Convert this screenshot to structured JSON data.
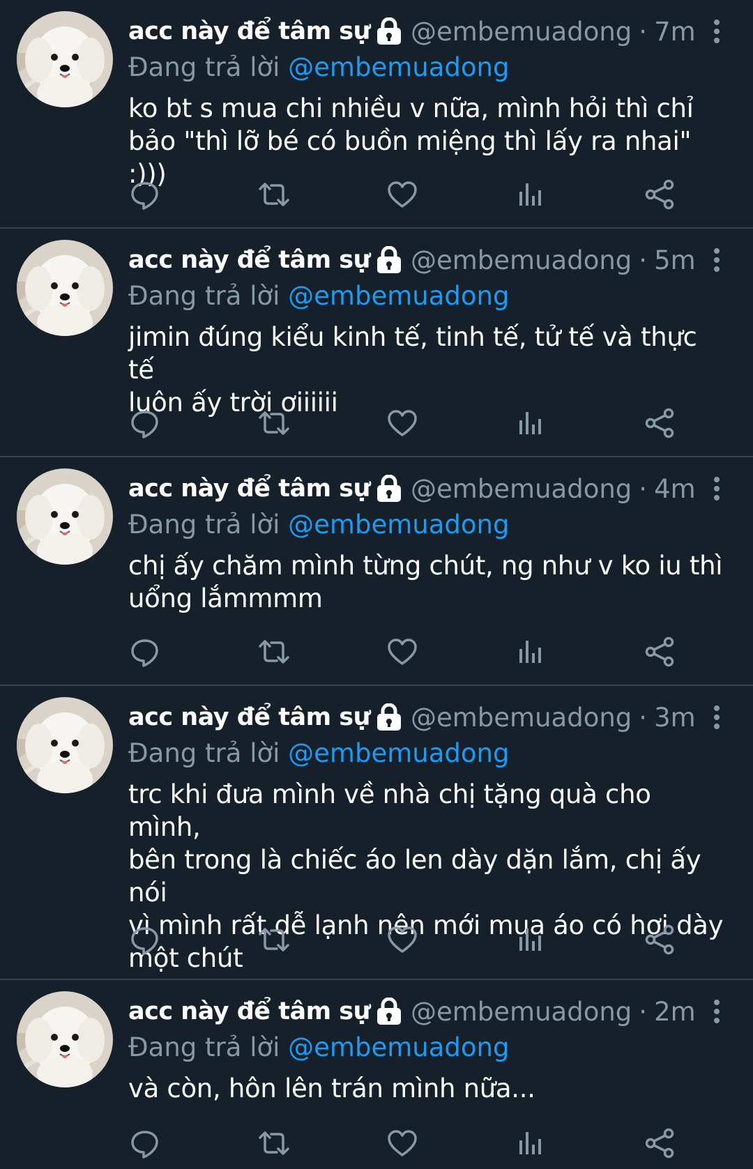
{
  "colors": {
    "background": "#15202b",
    "divider": "#38444d",
    "secondary_text": "#8899a6",
    "mention": "#1d9bf0",
    "primary_text": "#ffffff"
  },
  "icons": {
    "reply": "speech-bubble",
    "retweet": "retweet-arrows",
    "like": "heart-outline",
    "analytics": "bar-chart",
    "share": "share-nodes",
    "more": "vertical-ellipsis",
    "protected": "lock"
  },
  "tweets": [
    {
      "display_name": "acc này để tâm sự",
      "handle": "@embemuadong",
      "separator": "·",
      "time": "7m",
      "replying_prefix": "Đang trả lời",
      "replying_to": "@embemuadong",
      "text_lines": [
        "ko bt s mua chi nhiều v nữa, mình hỏi thì chỉ",
        "bảo \"thì lỡ bé có buồn miệng thì lấy ra nhai\" :)))"
      ]
    },
    {
      "display_name": "acc này để tâm sự",
      "handle": "@embemuadong",
      "separator": "·",
      "time": "5m",
      "replying_prefix": "Đang trả lời",
      "replying_to": "@embemuadong",
      "text_lines": [
        "jimin đúng kiểu kinh tế, tinh tế, tử tế và thực tế",
        "luôn ấy trời ơiiiiii"
      ]
    },
    {
      "display_name": "acc này để tâm sự",
      "handle": "@embemuadong",
      "separator": "·",
      "time": "4m",
      "replying_prefix": "Đang trả lời",
      "replying_to": "@embemuadong",
      "text_lines": [
        "chị ấy chăm mình từng chút, ng như v ko iu thì",
        "uổng lắmmmm"
      ]
    },
    {
      "display_name": "acc này để tâm sự",
      "handle": "@embemuadong",
      "separator": "·",
      "time": "3m",
      "replying_prefix": "Đang trả lời",
      "replying_to": "@embemuadong",
      "text_lines": [
        "trc khi đưa mình về nhà chị tặng quà cho mình,",
        "bên trong là chiếc áo len dày dặn lắm, chị ấy nói",
        "vì mình rất dễ lạnh nên mới mua áo có hơi dày",
        "một chút"
      ]
    },
    {
      "display_name": "acc này để tâm sự",
      "handle": "@embemuadong",
      "separator": "·",
      "time": "2m",
      "replying_prefix": "Đang trả lời",
      "replying_to": "@embemuadong",
      "text_lines": [
        "và còn, hôn lên trán mình nữa..."
      ]
    }
  ]
}
